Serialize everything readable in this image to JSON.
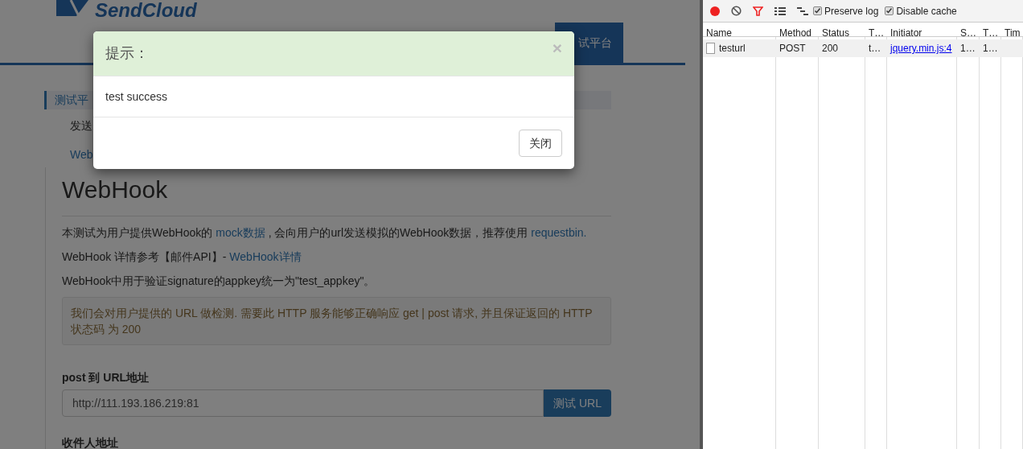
{
  "page": {
    "logo": "SendCloud",
    "nav_tab": {
      "label": "试平台",
      "selected": true
    },
    "sidebar": [
      {
        "label": "测试平",
        "selected": true,
        "kind": "header"
      },
      {
        "label": "发送",
        "selected": false,
        "kind": "text"
      },
      {
        "label": "Web",
        "selected": false,
        "kind": "link"
      }
    ],
    "heading": "WebHook",
    "paragraphs": [
      [
        {
          "kind": "text",
          "text": "本测试为用户提供WebHook的"
        },
        {
          "kind": "link",
          "text": "mock数据"
        },
        {
          "kind": "text",
          "text": ", 会向用户的url发送模拟的WebHook数据，推荐使用"
        },
        {
          "kind": "link",
          "text": "requestbin."
        }
      ],
      [
        {
          "kind": "text",
          "text": "WebHook 详情参考【邮件API】-"
        },
        {
          "kind": "link",
          "text": "WebHook详情"
        }
      ],
      [
        {
          "kind": "text",
          "text": "WebHook中用于验证signature的appkey统一为\"test_appkey\"。"
        }
      ]
    ],
    "notice": "我们会对用户提供的 URL 做检测. 需要此 HTTP 服务能够正确响应 get | post 请求, 并且保证返回的 HTTP 状态码 为 200",
    "url_label": "post 到 URL地址",
    "url_value": "http://111.193.186.219:81",
    "url_button": "测试 URL",
    "recipient_label": "收件人地址"
  },
  "modal": {
    "title": "提示：",
    "close": "×",
    "body": "test success",
    "button": "关闭"
  },
  "devtools": {
    "preserve_log": {
      "label": "Preserve log",
      "checked": true
    },
    "disable_cache": {
      "label": "Disable cache",
      "checked": true
    },
    "columns": [
      "Name",
      "Method",
      "Status",
      "T…",
      "Initiator",
      "S…",
      "T…",
      "Tim"
    ],
    "rows": [
      {
        "name": "testurl",
        "method": "POST",
        "status": "200",
        "column_4": "t…",
        "initiator": "jquery.min.js:4",
        "column_6": "1…",
        "column_7": "1…"
      }
    ]
  }
}
